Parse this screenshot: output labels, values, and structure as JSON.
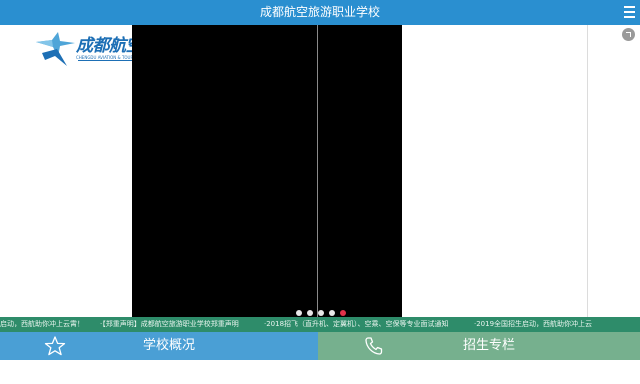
{
  "header": {
    "title": "成都航空旅游职业学校"
  },
  "logo": {
    "name_cn": "成都航空旅游职业学校",
    "name_en": "CHENGDU AVIATION & TOURISM VOCATIONAL SCHOOL"
  },
  "slider": {
    "dots": [
      {
        "active": false
      },
      {
        "active": false
      },
      {
        "active": false
      },
      {
        "active": false
      },
      {
        "active": true
      }
    ]
  },
  "ticker": {
    "items": [
      "启动，西航助你冲上云霄！",
      "·【郑重声明】成都航空旅游职业学校郑重声明",
      "·2018招飞（直升机、定翼机）、空乘、空保等专业面试通知",
      "·2019全国招生启动，西航助你冲上云"
    ]
  },
  "bottom_nav": {
    "school_overview": "学校概况",
    "admissions": "招生专栏"
  },
  "colors": {
    "header": "#2a8fd0",
    "nav_blue": "#4a9fd5",
    "nav_green": "#76b08e",
    "ticker": "#2e8c6a",
    "active_dot": "#e0334a"
  }
}
